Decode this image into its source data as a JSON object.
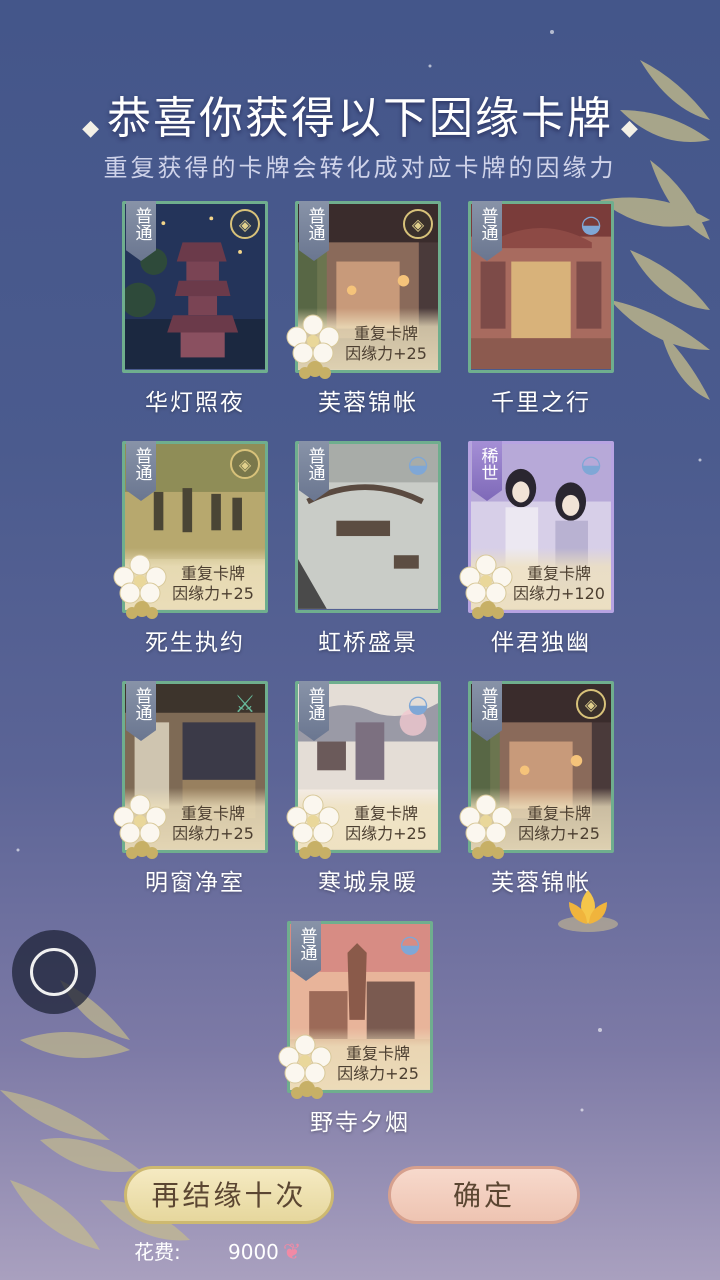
{
  "header": {
    "title": "恭喜你获得以下因缘卡牌",
    "subtitle": "重复获得的卡牌会转化成对应卡牌的因缘力"
  },
  "cards": [
    {
      "name": "华灯照夜",
      "rarity": "普通",
      "emblem": "coin-icon",
      "duplicate": false,
      "dup_label": "",
      "dup_value": ""
    },
    {
      "name": "芙蓉锦帐",
      "rarity": "普通",
      "emblem": "coin-icon",
      "duplicate": true,
      "dup_label": "重复卡牌",
      "dup_value": "因缘力+25"
    },
    {
      "name": "千里之行",
      "rarity": "普通",
      "emblem": "fan-icon",
      "duplicate": false,
      "dup_label": "",
      "dup_value": ""
    },
    {
      "name": "死生执约",
      "rarity": "普通",
      "emblem": "coin-icon",
      "duplicate": true,
      "dup_label": "重复卡牌",
      "dup_value": "因缘力+25"
    },
    {
      "name": "虹桥盛景",
      "rarity": "普通",
      "emblem": "fan-icon",
      "duplicate": false,
      "dup_label": "",
      "dup_value": ""
    },
    {
      "name": "伴君独幽",
      "rarity": "稀世",
      "emblem": "fan-icon",
      "duplicate": true,
      "dup_label": "重复卡牌",
      "dup_value": "因缘力+120"
    },
    {
      "name": "明窗净室",
      "rarity": "普通",
      "emblem": "sword-icon",
      "duplicate": true,
      "dup_label": "重复卡牌",
      "dup_value": "因缘力+25"
    },
    {
      "name": "寒城泉暖",
      "rarity": "普通",
      "emblem": "fan-icon",
      "duplicate": true,
      "dup_label": "重复卡牌",
      "dup_value": "因缘力+25"
    },
    {
      "name": "芙蓉锦帐",
      "rarity": "普通",
      "emblem": "coin-icon",
      "duplicate": true,
      "dup_label": "重复卡牌",
      "dup_value": "因缘力+25"
    },
    {
      "name": "野寺夕烟",
      "rarity": "普通",
      "emblem": "fan-icon",
      "duplicate": true,
      "dup_label": "重复卡牌",
      "dup_value": "因缘力+25"
    }
  ],
  "buttons": {
    "again_label": "再结缘十次",
    "confirm_label": "确定"
  },
  "cost": {
    "label": "花费:",
    "value": "9000",
    "currency_icon": "butterfly-icon"
  },
  "colors": {
    "common_border": "#6fae8e",
    "rare_border": "#b7a3e2",
    "button_gold": "#e6d79d",
    "button_pink": "#eec4b2"
  }
}
